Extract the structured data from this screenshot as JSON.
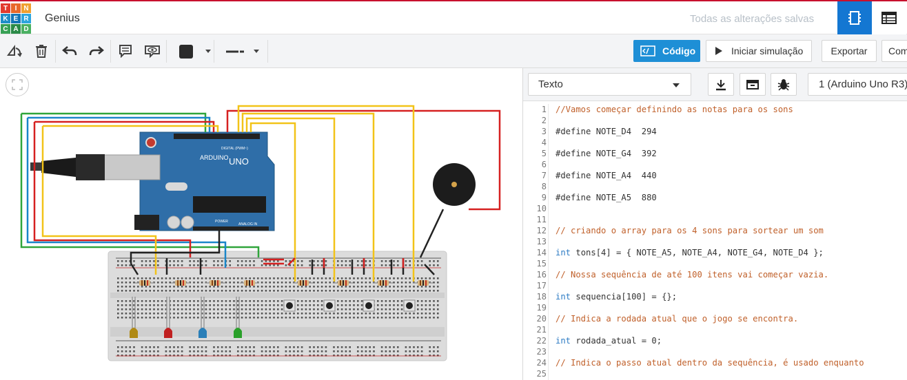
{
  "logo_letters": [
    "T",
    "I",
    "N",
    "K",
    "E",
    "R",
    "C",
    "A",
    "D"
  ],
  "logo_colors": [
    "#e23b2e",
    "#e8692b",
    "#f0a030",
    "#1f8ec8",
    "#1576b8",
    "#2da5dd",
    "#37a055",
    "#2b8a48",
    "#4ab062"
  ],
  "header": {
    "title": "Genius",
    "save_status": "Todas as alterações salvas"
  },
  "toolbar": {
    "code_label": "Código",
    "simulate_label": "Iniciar simulação",
    "export_label": "Exportar",
    "share_label": "Com"
  },
  "code_panel": {
    "mode": "Texto",
    "board": "1 (Arduino Uno R3)",
    "lines": [
      {
        "n": "1",
        "text": "//Vamos começar definindo as notas para os sons",
        "kind": "comment"
      },
      {
        "n": "2",
        "text": "",
        "kind": "plain"
      },
      {
        "n": "3",
        "text": "#define NOTE_D4  294",
        "kind": "plain"
      },
      {
        "n": "4",
        "text": "",
        "kind": "plain"
      },
      {
        "n": "5",
        "text": "#define NOTE_G4  392",
        "kind": "plain"
      },
      {
        "n": "6",
        "text": "",
        "kind": "plain"
      },
      {
        "n": "7",
        "text": "#define NOTE_A4  440",
        "kind": "plain"
      },
      {
        "n": "8",
        "text": "",
        "kind": "plain"
      },
      {
        "n": "9",
        "text": "#define NOTE_A5  880",
        "kind": "plain"
      },
      {
        "n": "10",
        "text": "",
        "kind": "plain"
      },
      {
        "n": "11",
        "text": "",
        "kind": "plain"
      },
      {
        "n": "12",
        "text": "// criando o array para os 4 sons para sortear um som",
        "kind": "comment"
      },
      {
        "n": "13",
        "text": "",
        "kind": "plain"
      },
      {
        "n": "14",
        "text": "int tons[4] = { NOTE_A5, NOTE_A4, NOTE_G4, NOTE_D4 };",
        "kind": "code"
      },
      {
        "n": "15",
        "text": "",
        "kind": "plain"
      },
      {
        "n": "16",
        "text": "// Nossa sequência de até 100 itens vai começar vazia.",
        "kind": "comment"
      },
      {
        "n": "17",
        "text": "",
        "kind": "plain"
      },
      {
        "n": "18",
        "text": "int sequencia[100] = {};",
        "kind": "code"
      },
      {
        "n": "19",
        "text": "",
        "kind": "plain"
      },
      {
        "n": "20",
        "text": "// Indica a rodada atual que o jogo se encontra.",
        "kind": "comment"
      },
      {
        "n": "21",
        "text": "",
        "kind": "plain"
      },
      {
        "n": "22",
        "text": "int rodada_atual = 0;",
        "kind": "code"
      },
      {
        "n": "23",
        "text": "",
        "kind": "plain"
      },
      {
        "n": "24",
        "text": "// Indica o passo atual dentro da sequência, é usado enquanto",
        "kind": "comment"
      },
      {
        "n": "25",
        "text": "",
        "kind": "plain"
      }
    ]
  },
  "circuit": {
    "board_brand": "ARDUINO",
    "board_model": "UNO",
    "board_digital_label": "DIGITAL (PWM~)",
    "board_analog_label": "ANALOG IN",
    "board_power_label": "POWER",
    "led_colors": [
      "#b08a14",
      "#c02020",
      "#2a7fb8",
      "#2aa02a"
    ],
    "wire_colors": {
      "yellow": "#f2c318",
      "red": "#d62020",
      "green": "#2fa53a",
      "blue": "#1a86c9",
      "black": "#222222"
    }
  }
}
